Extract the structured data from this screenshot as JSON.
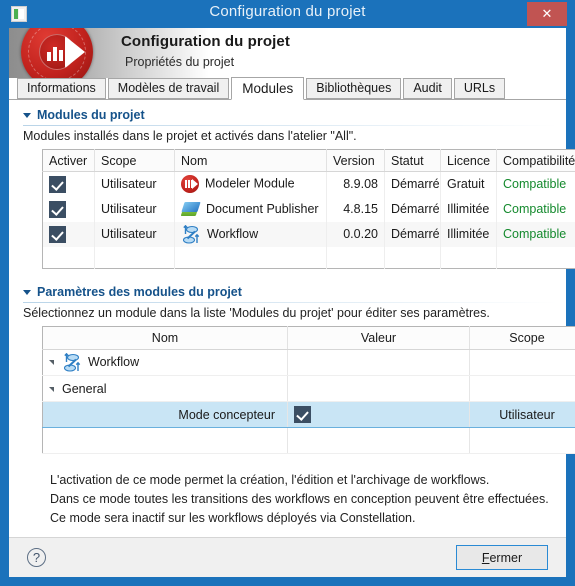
{
  "window": {
    "title": "Configuration du projet",
    "icon": "app-icon",
    "close_label": "✕"
  },
  "banner": {
    "title": "Configuration du projet",
    "subtitle": "Propriétés du projet",
    "logo": "modeler-logo"
  },
  "tabs": [
    {
      "label": "Informations",
      "active": false
    },
    {
      "label": "Modèles de travail",
      "active": false
    },
    {
      "label": "Modules",
      "active": true
    },
    {
      "label": "Bibliothèques",
      "active": false
    },
    {
      "label": "Audit",
      "active": false
    },
    {
      "label": "URLs",
      "active": false
    }
  ],
  "modules_section": {
    "title": "Modules du projet",
    "description": "Modules installés dans le projet et activés dans l'atelier \"All\".",
    "columns": [
      "Activer",
      "Scope",
      "Nom",
      "Version",
      "Statut",
      "Licence",
      "Compatibilité"
    ],
    "rows": [
      {
        "activer": true,
        "scope": "Utilisateur",
        "icon": "modeler-module-icon",
        "nom": "Modeler Module",
        "version": "8.9.08",
        "statut": "Démarré",
        "licence": "Gratuit",
        "compatibilite": "Compatible"
      },
      {
        "activer": true,
        "scope": "Utilisateur",
        "icon": "document-publisher-icon",
        "nom": "Document Publisher",
        "version": "4.8.15",
        "statut": "Démarré",
        "licence": "Illimitée",
        "compatibilite": "Compatible"
      },
      {
        "activer": true,
        "scope": "Utilisateur",
        "icon": "workflow-icon",
        "nom": "Workflow",
        "version": "0.0.20",
        "statut": "Démarré",
        "licence": "Illimitée",
        "compatibilite": "Compatible"
      }
    ]
  },
  "params_section": {
    "title": "Paramètres des modules du projet",
    "description": "Sélectionnez un module dans la liste 'Modules du projet' pour éditer ses paramètres.",
    "columns": [
      "Nom",
      "Valeur",
      "Scope"
    ],
    "rows": [
      {
        "nom": "Workflow",
        "icon": "workflow-icon",
        "level": 1,
        "expanded": true,
        "valeur": "",
        "scope": "",
        "selected": false
      },
      {
        "nom": "General",
        "icon": "",
        "level": 2,
        "expanded": true,
        "valeur": "",
        "scope": "",
        "selected": false
      },
      {
        "nom": "Mode concepteur",
        "icon": "",
        "level": 3,
        "expanded": false,
        "valeur_checkbox": true,
        "scope": "Utilisateur",
        "selected": true
      }
    ]
  },
  "help_text": {
    "line1": "L'activation de ce mode permet la création, l'édition et l'archivage de workflows.",
    "line2": "Dans ce mode toutes les transitions des workflows en conception peuvent être effectuées.",
    "line3": "Ce mode sera inactif sur les workflows déployés via Constellation."
  },
  "footer": {
    "help_icon": "question-mark-icon",
    "help_glyph": "?",
    "close_button": "Fermer",
    "close_button_accel": "F",
    "close_button_rest": "ermer"
  },
  "colors": {
    "window_frame": "#1b72bb",
    "close_button": "#c15452",
    "section_title": "#15528a",
    "compatible": "#158a2e",
    "selection": "#c9e5f5",
    "checkbox": "#3b4e63"
  }
}
